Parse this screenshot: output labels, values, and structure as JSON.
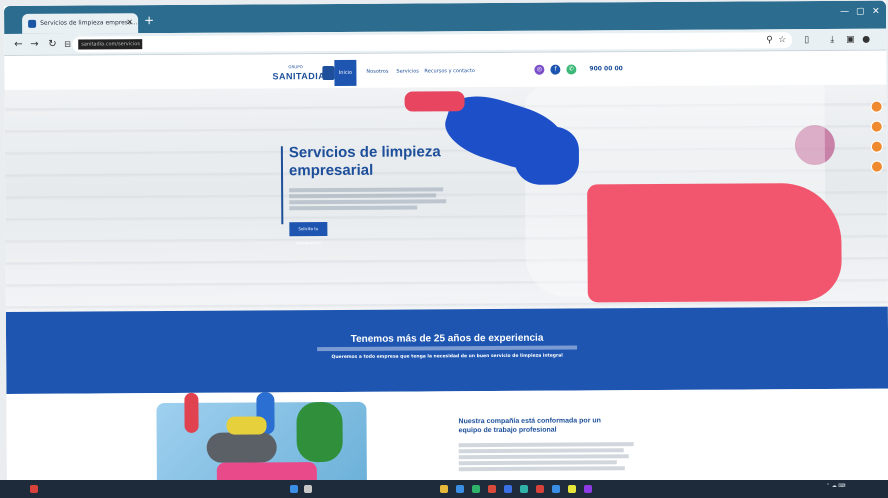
{
  "browser": {
    "tab_title": "Servicios de limpieza empresa...",
    "tab_close": "×",
    "new_tab": "+",
    "url": "sanitadia.com/servicios",
    "nav": {
      "back": "←",
      "forward": "→",
      "reload": "↻",
      "site_info": "⊟"
    },
    "window_controls": [
      "—",
      "▢",
      "✕"
    ]
  },
  "site": {
    "logo": {
      "brand": "SANITADIA",
      "tagline": "GRUPO"
    },
    "menu": {
      "active": "Inicio",
      "items": [
        "Nosotros",
        "Servicios",
        "Recursos y contacto"
      ]
    },
    "phone": "900 00 00",
    "colors": {
      "primary": "#1d55b0",
      "accent": "#f08a2e",
      "text_blue": "#1d4f9a"
    }
  },
  "hero": {
    "title": "Servicios de limpieza empresarial",
    "button": "Solicita tu presupuesto"
  },
  "band": {
    "title": "Tenemos más de 25 años de experiencia",
    "subtitle2": "Queremos a todo empresa que tenga la necesidad de un buen servicio de limpieza integral"
  },
  "about": {
    "title": "Nuestra compañía está conformada por un equipo de trabajo profesional"
  }
}
